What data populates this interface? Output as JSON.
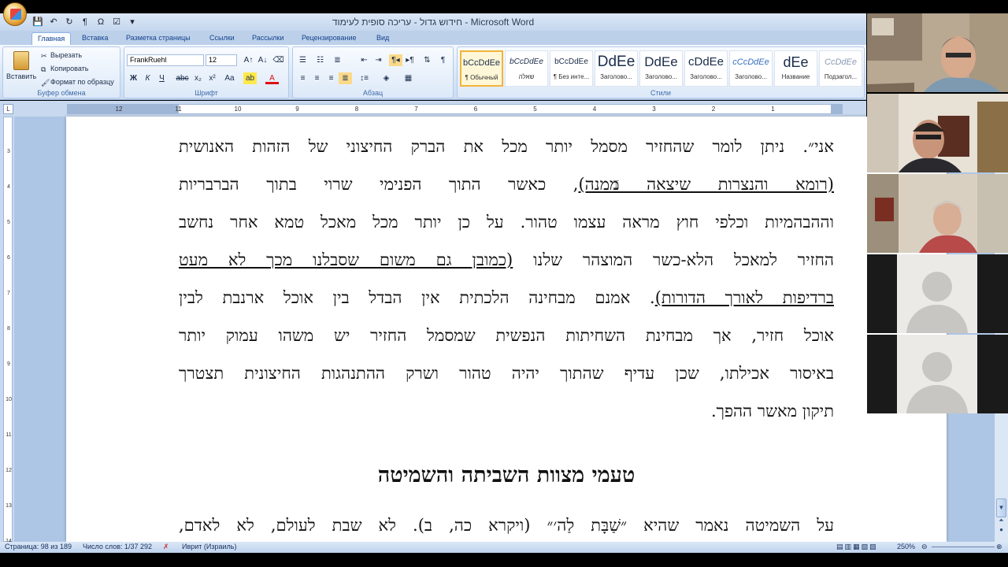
{
  "window": {
    "title": "חידוש גדול - עריכה סופית לעימוד - Microsoft Word"
  },
  "quick_access": {
    "icons": [
      "save-icon",
      "undo-icon",
      "redo-icon",
      "paragraph-icon",
      "omega-icon",
      "check-icon",
      "dropdown-icon"
    ]
  },
  "tabs": [
    "Главная",
    "Вставка",
    "Разметка страницы",
    "Ссылки",
    "Рассылки",
    "Рецензирование",
    "Вид"
  ],
  "clipboard": {
    "paste_label": "Вставить",
    "cut_label": "Вырезать",
    "copy_label": "Копировать",
    "format_painter_label": "Формат по образцу",
    "group_label": "Буфер обмена"
  },
  "font": {
    "family_value": "FrankRuehl",
    "size_value": "12",
    "group_label": "Шрифт"
  },
  "paragraph": {
    "group_label": "Абзац"
  },
  "styles": {
    "group_label": "Стили",
    "tiles": [
      {
        "preview": "bCcDdEe",
        "name": "¶ Обычный"
      },
      {
        "preview": "bCcDdEe",
        "name": "שאלה"
      },
      {
        "preview": "bCcDdEe",
        "name": "¶ Без инте..."
      },
      {
        "preview": "DdEe",
        "name": "Заголово..."
      },
      {
        "preview": "DdEe",
        "name": "Заголово..."
      },
      {
        "preview": "cDdEe",
        "name": "Заголово..."
      },
      {
        "preview": "cCcDdEe",
        "name": "Заголово..."
      },
      {
        "preview": "dEe",
        "name": "Название"
      },
      {
        "preview": "CcDdEe",
        "name": "Подзагол..."
      }
    ]
  },
  "ruler": {
    "numbers": [
      "12",
      "11",
      "10",
      "9",
      "8",
      "7",
      "6",
      "5",
      "4",
      "3",
      "2",
      "1"
    ],
    "vertical_numbers": [
      "3",
      "4",
      "5",
      "6",
      "7",
      "8",
      "9",
      "10",
      "11",
      "12",
      "13",
      "14"
    ],
    "corner_label": "L"
  },
  "document": {
    "lines": [
      {
        "pre": "אני״. ניתן לומר שהחזיר מסמל יותר מכל את הברק החיצוני של הזהות האנושית",
        "ul": "",
        "post": ""
      },
      {
        "pre": "",
        "ul": "(רומא והנצרות שיצאה ממנה)",
        "post": ", כאשר התוך הפנימי שרוי בתוך הברבריות"
      },
      {
        "pre": "וההבהמיות וכלפי חוץ מראה עצמו טהור. על כן יותר מכל מאכל טמא  אחר נחשב",
        "ul": "",
        "post": ""
      },
      {
        "pre": "החזיר למאכל הלא-כשר המוצהר שלנו ",
        "ul": "(כמובן גם משום שסבלנו מכך לא מעט",
        "post": ""
      },
      {
        "pre": "",
        "ul": "ברדיפות לאורך הדורות)",
        "post": ". אמנם מבחינה הלכתית אין הבדל בין אוכל ארנבת לבין"
      },
      {
        "pre": "אוכל חזיר, אך מבחינת השחיתות הנפשית שמסמל החזיר יש משהו עמוק יותר",
        "ul": "",
        "post": ""
      },
      {
        "pre": "באיסור אכילתו, שכן עדיף שהתוך יהיה טהור ושרק ההתנהגות החיצונית תצטרך",
        "ul": "",
        "post": ""
      },
      {
        "pre": "תיקון מאשר ההפך.",
        "ul": "",
        "post": ""
      }
    ],
    "heading": "טעמי מצוות השביתה והשמיטה",
    "para2": "על השמיטה נאמר שהיא ״שַׁבָּת לַה׳״ (ויקרא כה, ב). לא שבת לעולם, לא לאדם,"
  },
  "statusbar": {
    "page": "Страница: 98 из 189",
    "words": "Число слов: 1/37 292",
    "language": "Иврит (Израиль)",
    "zoom": "250%"
  },
  "video_tiles": [
    {
      "name": "participant-1",
      "kind": "camera"
    },
    {
      "name": "participant-2",
      "kind": "camera"
    },
    {
      "name": "participant-3",
      "kind": "camera"
    },
    {
      "name": "participant-4",
      "kind": "placeholder"
    },
    {
      "name": "participant-5",
      "kind": "placeholder"
    }
  ]
}
